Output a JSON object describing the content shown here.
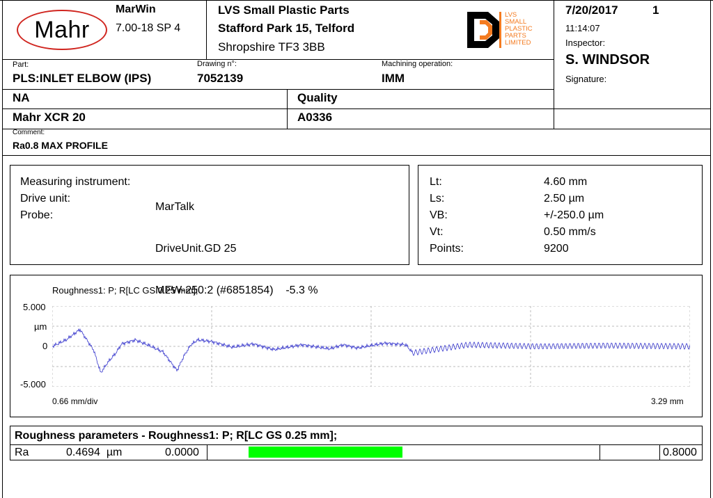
{
  "header": {
    "logo_text": "Mahr",
    "software": "MarWin",
    "version": "7.00-18 SP 4",
    "company_name": "LVS Small Plastic Parts",
    "company_address1": "Stafford Park 15, Telford",
    "company_address2": "Shropshire TF3 3BB",
    "company_logo_lines": [
      "LVS",
      "SMALL",
      "PLASTIC",
      "PARTS",
      "LIMITED"
    ],
    "date": "7/20/2017",
    "page": "1",
    "time": "11:14:07",
    "inspector_label": "Inspector:",
    "inspector": "S. WINDSOR",
    "signature_label": "Signature:"
  },
  "part": {
    "part_label": "Part:",
    "part_value": "PLS:INLET ELBOW (IPS)",
    "drawing_label": "Drawing n°:",
    "drawing_value": "7052139",
    "operation_label": "Machining operation:",
    "operation_value": "IMM",
    "row2_left": "NA",
    "row2_right": "Quality",
    "row3_left": "Mahr XCR 20",
    "row3_right": "A0336",
    "comment_label": "Comment:",
    "comment_value": "Ra0.8 MAX PROFILE"
  },
  "instrument": {
    "labels": [
      "Measuring instrument:",
      "Drive unit:",
      "Probe:"
    ],
    "values": [
      "MarTalk",
      "DriveUnit.GD 25",
      "MFW-250:2 (#6851854)    -5.3 %"
    ]
  },
  "settings": {
    "labels": [
      "Lt:",
      "Ls:",
      "VB:",
      "Vt:",
      "Points:"
    ],
    "values": [
      "4.60 mm",
      "2.50 µm",
      "+/-250.0 µm",
      "0.50 mm/s",
      "9200"
    ]
  },
  "chart_data": {
    "type": "line",
    "title": "Roughness1: P; R[LC GS 0.25 mm];",
    "ylabel": "µm",
    "y_ticks": [
      "5.000",
      "µm",
      "0",
      "-5.000"
    ],
    "ylim": [
      -5,
      5
    ],
    "x_start_label": "0.66 mm/div",
    "x_end_label": "3.29 mm",
    "grid": true,
    "series": [
      {
        "x": [
          0,
          0.1,
          0.2,
          0.3,
          0.35,
          0.4,
          0.46,
          0.5,
          0.6,
          0.7,
          0.8,
          0.9,
          0.95,
          1.0,
          1.05,
          1.15,
          1.3,
          1.45,
          1.6,
          1.8,
          2.0,
          2.1,
          2.2,
          2.4,
          2.55,
          2.6,
          3.0,
          3.5,
          4.0,
          4.6
        ],
        "y": [
          0,
          0.8,
          2.1,
          -0.5,
          -3.3,
          -2.0,
          -0.8,
          0.3,
          0.8,
          0.1,
          -0.7,
          -3.0,
          -1.2,
          0.2,
          0.8,
          0.6,
          -0.1,
          0.3,
          -0.4,
          0.2,
          -0.3,
          0.2,
          -0.2,
          0.4,
          0.2,
          -0.8,
          0.2,
          0.0,
          0.1,
          0.0
        ]
      }
    ]
  },
  "params": {
    "title": "Roughness parameters - Roughness1: P; R[LC GS 0.25 mm];",
    "name": "Ra",
    "value": "0.4694  µm",
    "lower": "0.0000",
    "upper": "0.8000",
    "fraction": 0.4694,
    "bar_color": "#00ff00"
  }
}
